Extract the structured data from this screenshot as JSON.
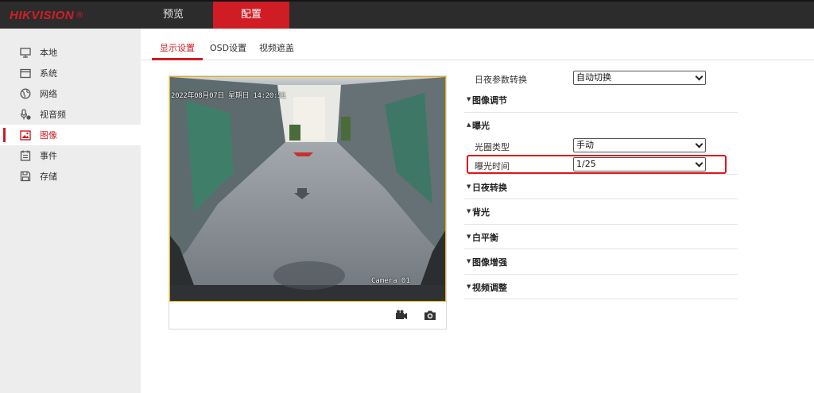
{
  "header": {
    "logo_text": "HIKVISION",
    "logo_reg": "®",
    "nav": [
      {
        "label": "预览",
        "active": false
      },
      {
        "label": "配置",
        "active": true
      }
    ]
  },
  "sidebar": {
    "items": [
      {
        "label": "本地",
        "icon": "monitor-icon"
      },
      {
        "label": "系统",
        "icon": "system-icon"
      },
      {
        "label": "网络",
        "icon": "globe-icon"
      },
      {
        "label": "视音频",
        "icon": "mic-icon"
      },
      {
        "label": "图像",
        "icon": "image-icon",
        "active": true
      },
      {
        "label": "事件",
        "icon": "calendar-icon"
      },
      {
        "label": "存储",
        "icon": "disk-icon"
      }
    ]
  },
  "subtabs": [
    {
      "label": "显示设置",
      "active": true
    },
    {
      "label": "OSD设置"
    },
    {
      "label": "视频遮盖"
    }
  ],
  "video": {
    "osd_time": "2022年08月07日 星期日 14:20:51",
    "osd_camera": "Camera 01"
  },
  "settings": {
    "day_night_param": {
      "label": "日夜参数转换",
      "value": "自动切换"
    },
    "image_adjust": {
      "title": "图像调节",
      "expanded": false
    },
    "exposure": {
      "title": "曝光",
      "expanded": true
    },
    "iris_type": {
      "label": "光圈类型",
      "value": "手动"
    },
    "exposure_time": {
      "label": "曝光时间",
      "value": "1/25"
    },
    "collapsed_sections": [
      "日夜转换",
      "背光",
      "白平衡",
      "图像增强",
      "视频调整"
    ]
  },
  "colors": {
    "accent": "#d01c24",
    "topbar": "#2c2c2c",
    "sidebar": "#ededed",
    "highlight": "#e0141c"
  }
}
